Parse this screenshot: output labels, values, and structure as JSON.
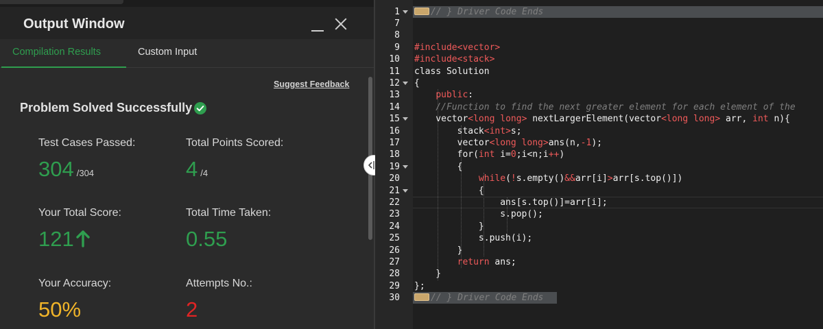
{
  "output_window": {
    "title": "Output Window",
    "tabs": [
      {
        "label": "Compilation Results",
        "active": true
      },
      {
        "label": "Custom Input",
        "active": false
      }
    ],
    "suggest_feedback": "Suggest Feedback",
    "status": "Problem Solved Successfully",
    "stats": {
      "test_cases_label": "Test Cases Passed:",
      "test_cases_value": "304",
      "test_cases_total": "/304",
      "points_label": "Total Points Scored:",
      "points_value": "4",
      "points_total": "/4",
      "score_label": "Your Total Score:",
      "score_value": "121",
      "time_label": "Total Time Taken:",
      "time_value": "0.55",
      "accuracy_label": "Your Accuracy:",
      "accuracy_value": "50%",
      "attempts_label": "Attempts No.:",
      "attempts_value": "2"
    },
    "icons": {
      "minimize": "minimize-icon",
      "close": "close-icon",
      "success": "check-circle-icon",
      "score_trend": "arrow-up-icon"
    },
    "colors": {
      "success": "#2f9e4f",
      "accuracy": "#f0b429",
      "attempts": "#e02424"
    }
  },
  "editor": {
    "line_numbers": [
      "1",
      "7",
      "8",
      "9",
      "10",
      "11",
      "12",
      "13",
      "14",
      "15",
      "16",
      "17",
      "18",
      "19",
      "20",
      "21",
      "22",
      "23",
      "24",
      "25",
      "26",
      "27",
      "28",
      "29",
      "30"
    ],
    "lines": [
      "// } Driver Code Ends",
      "",
      "",
      "#include<vector>",
      "#include<stack>",
      "class Solution",
      "{",
      "    public:",
      "    //Function to find the next greater element for each element of the",
      "    vector<long long> nextLargerElement(vector<long long> arr, int n){",
      "        stack<int>s;",
      "        vector<long long>ans(n,-1);",
      "        for(int i=0;i<n;i++)",
      "        {",
      "            while(!s.empty()&&arr[i]>arr[s.top()])",
      "            {",
      "                ans[s.top()]=arr[i];",
      "                s.pop();",
      "            }",
      "            s.push(i);",
      "        }",
      "        return ans;",
      "    }",
      "};",
      "// } Driver Code Ends"
    ]
  }
}
